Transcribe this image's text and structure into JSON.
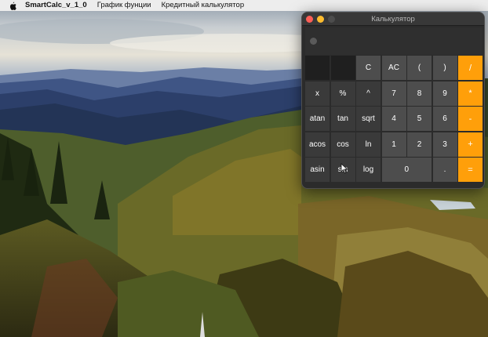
{
  "menubar": {
    "app_name": "SmartCalc_v_1_0",
    "items": [
      "График фунции",
      "Кредитный калькулятор"
    ]
  },
  "calculator": {
    "title": "Калькулятор",
    "display": "",
    "rows": [
      [
        {
          "label": "",
          "kind": "blank"
        },
        {
          "label": "",
          "kind": "blank"
        },
        {
          "label": "C",
          "kind": "digit"
        },
        {
          "label": "AC",
          "kind": "digit"
        },
        {
          "label": "(",
          "kind": "digit"
        },
        {
          "label": ")",
          "kind": "digit"
        },
        {
          "label": "/",
          "kind": "op"
        }
      ],
      [
        {
          "label": "x",
          "kind": "fn"
        },
        {
          "label": "%",
          "kind": "fn"
        },
        {
          "label": "^",
          "kind": "fn"
        },
        {
          "label": "7",
          "kind": "digit"
        },
        {
          "label": "8",
          "kind": "digit"
        },
        {
          "label": "9",
          "kind": "digit"
        },
        {
          "label": "*",
          "kind": "op"
        }
      ],
      [
        {
          "label": "atan",
          "kind": "fn"
        },
        {
          "label": "tan",
          "kind": "fn"
        },
        {
          "label": "sqrt",
          "kind": "fn"
        },
        {
          "label": "4",
          "kind": "digit"
        },
        {
          "label": "5",
          "kind": "digit"
        },
        {
          "label": "6",
          "kind": "digit"
        },
        {
          "label": "-",
          "kind": "op"
        }
      ],
      [
        {
          "label": "acos",
          "kind": "fn"
        },
        {
          "label": "cos",
          "kind": "fn"
        },
        {
          "label": "ln",
          "kind": "fn"
        },
        {
          "label": "1",
          "kind": "digit"
        },
        {
          "label": "2",
          "kind": "digit"
        },
        {
          "label": "3",
          "kind": "digit"
        },
        {
          "label": "+",
          "kind": "op"
        }
      ],
      [
        {
          "label": "asin",
          "kind": "fn"
        },
        {
          "label": "sin",
          "kind": "fn"
        },
        {
          "label": "log",
          "kind": "fn"
        },
        {
          "label": "0",
          "kind": "zero"
        },
        {
          "label": ".",
          "kind": "digit"
        },
        {
          "label": "=",
          "kind": "op"
        }
      ]
    ]
  },
  "colors": {
    "operator_orange": "#ff9f0a",
    "digit_key": "#4d4d4d",
    "function_key": "#3a3a3a",
    "window_bg": "#2b2b2b"
  },
  "icons": [
    "apple-icon",
    "close-icon",
    "minimize-icon",
    "zoom-icon",
    "mouse-pointer-icon"
  ]
}
